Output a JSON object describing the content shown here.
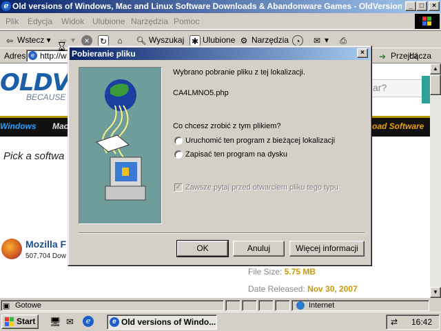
{
  "window": {
    "title": "Old versions of Windows, Mac and Linux Software Downloads & Abandonware Games - OldVersion.c...",
    "min": "_",
    "max": "□",
    "close": "×"
  },
  "menu": [
    "Plik",
    "Edycja",
    "Widok",
    "Ulubione",
    "Narzędzia",
    "Pomoc"
  ],
  "toolbar": {
    "back": "Wstecz",
    "search": "Wyszukaj",
    "favorites": "Ulubione",
    "tools": "Narzędzia"
  },
  "address": {
    "label": "Adres",
    "value": "http://w",
    "go": "Przejdź",
    "links": "Łącza"
  },
  "page": {
    "logo": "OLDVE",
    "tagline": "BECAUSE N",
    "search_hint": "ar?",
    "nav_windows": "Windows",
    "nav_mac": "Mac",
    "nav_right": "oad Software",
    "pick": "Pick a softwa",
    "mozilla_name": "Mozilla F",
    "mozilla_downloads": "507,704 Dow",
    "filesize_label": "File Size:",
    "filesize_value": "5.75 MB",
    "released_label": "Date Released:",
    "released_value": "Nov 30, 2007"
  },
  "status": {
    "text": "Gotowe",
    "zone": "Internet"
  },
  "taskbar": {
    "start": "Start",
    "window": "Old versions of Windo...",
    "clock": "16:42"
  },
  "dialog": {
    "title": "Pobieranie pliku",
    "close": "×",
    "intro": "Wybrano pobranie pliku z tej lokalizacji.",
    "filename": "CA4LMNO5.php",
    "question": "Co chcesz zrobić z tym plikiem?",
    "option_run": "Uruchomić ten program z bieżącej lokalizacji",
    "option_save": "Zapisać ten program na dysku",
    "always_ask": "Zawsze pytaj przed otwarciem pliku tego typu",
    "ok": "OK",
    "cancel": "Anuluj",
    "more": "Więcej informacji"
  },
  "colors": {
    "titlebar_start": "#0a246a",
    "titlebar_end": "#a6caf0",
    "dialog_image_bg": "#6f9d9c",
    "nav_accent": "#0099ff",
    "nav_orange": "#e8a000"
  }
}
